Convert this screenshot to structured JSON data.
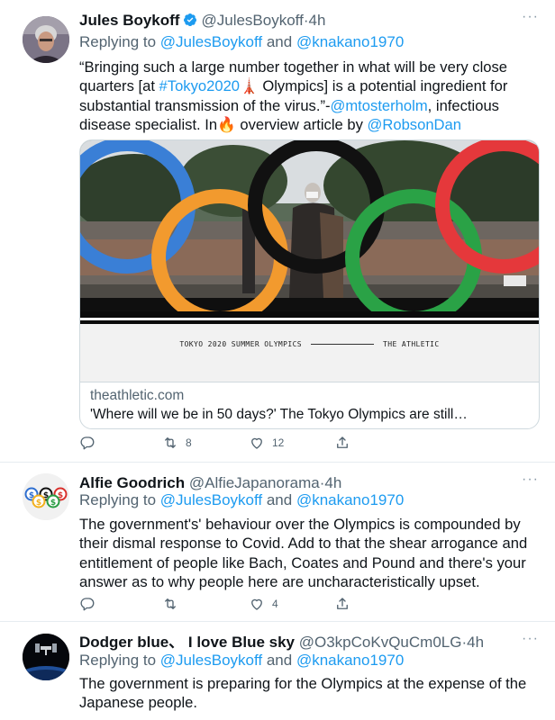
{
  "tweets": [
    {
      "name": "Jules Boykoff",
      "handle": "@JulesBoykoff",
      "time": "4h",
      "replying_prefix": "Replying to ",
      "reply_to_1": "@JulesBoykoff",
      "reply_and": " and ",
      "reply_to_2": "@knakano1970",
      "text_1": "“Bringing such a large number together in what will be very close quarters [at ",
      "hashtag": "#Tokyo2020",
      "emoji_tower": "🗼",
      "text_2": " Olympics] is a potential ingredient for substantial transmission of the virus.”-",
      "mention_1": "@mtosterholm",
      "text_3": ", infectious disease specialist. In",
      "emoji_fire": "🔥",
      "text_4": " overview article by ",
      "mention_2": "@RobsonDan",
      "card": {
        "banner_left": "TOKYO 2020 SUMMER OLYMPICS",
        "banner_right": "THE ATHLETIC",
        "domain": "theathletic.com",
        "title": "'Where will we be in 50 days?' The Tokyo Olympics are still…"
      },
      "actions": {
        "retweets": "8",
        "likes": "12"
      }
    },
    {
      "name": "Alfie Goodrich",
      "handle": "@AlfieJapanorama",
      "time": "4h",
      "replying_prefix": "Replying to ",
      "reply_to_1": "@JulesBoykoff",
      "reply_and": " and ",
      "reply_to_2": "@knakano1970",
      "text": "The government's' behaviour over the Olympics is compounded by their dismal response to Covid. Add to that the shear arrogance and entitlement of people like Bach, Coates and Pound and there's your answer as to why people here are uncharacteristically upset.",
      "actions": {
        "likes": "4"
      }
    },
    {
      "name": "Dodger blue、 I love Blue sky",
      "handle": "@O3kpCoKvQuCm0LG",
      "time": "4h",
      "replying_prefix": "Replying to ",
      "reply_to_1": "@JulesBoykoff",
      "reply_and": " and ",
      "reply_to_2": "@knakano1970",
      "text": "The government is preparing for the Olympics at the expense of the Japanese people."
    }
  ],
  "separator_dot": "·",
  "more_glyph": "···",
  "colors": {
    "accent": "#1d9bf0",
    "muted": "#536471",
    "text": "#0f1419",
    "verified": "#1d9bf0"
  }
}
